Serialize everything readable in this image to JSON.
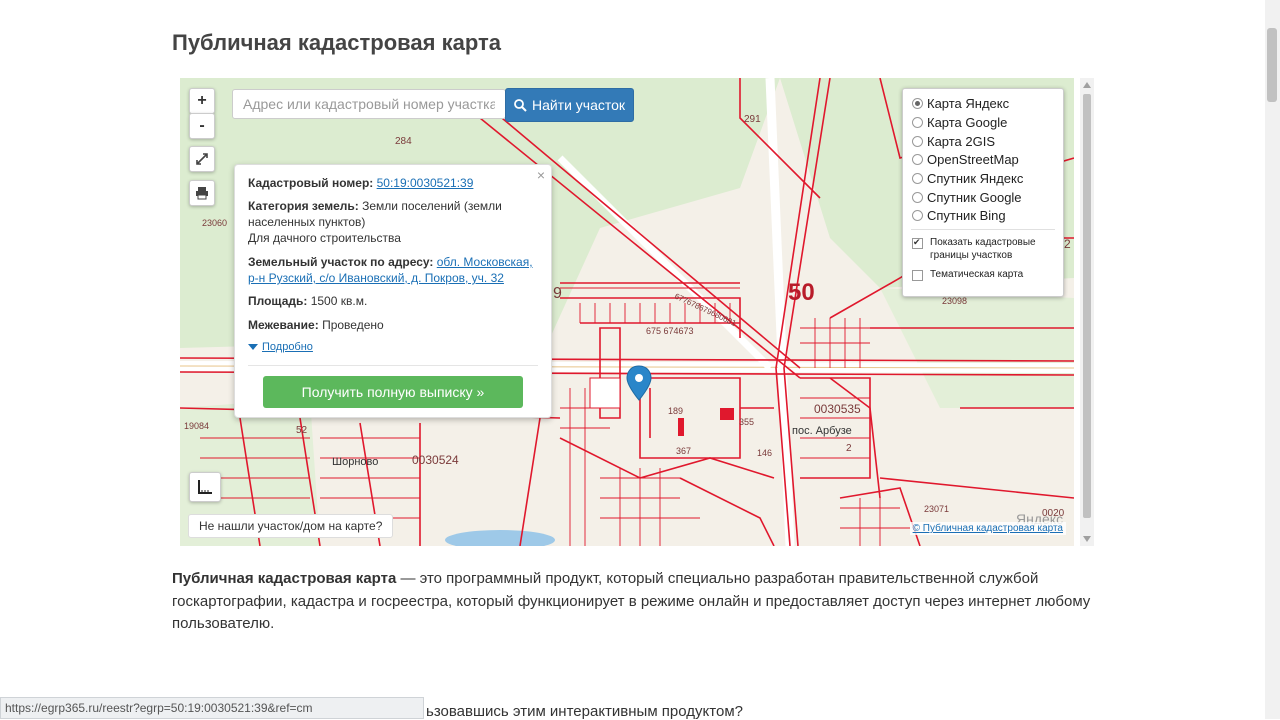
{
  "page": {
    "title": "Публичная кадастровая карта",
    "intro_bold": "Публичная кадастровая карта",
    "intro_rest": " — это программный продукт, который специально разработан правительственной службой госкартографии, кадастра и госреестра, который функционирует в режиме онлайн и предоставляет доступ через интернет любому пользователю.",
    "next_fragment": "ьзовавшись этим интерактивным продуктом?"
  },
  "map": {
    "zoom_in": "+",
    "zoom_out": "-",
    "search_placeholder": "Адрес или кадастровый номер участка",
    "search_button": "Найти участок",
    "not_found_button": "Не нашли участок/дом на карте?",
    "attribution": "© Публичная кадастровая карта",
    "map_labels": {
      "l291": "291",
      "l284": "284",
      "l23060": "23060",
      "l19084": "19084",
      "l52": "52",
      "l9": "9",
      "l50": "50",
      "l23098": "23098",
      "l2": "2",
      "l675": "675 674673",
      "l677": "677678679680681",
      "l189": "189",
      "l355": "355",
      "l367": "367",
      "l146": "146",
      "l0030535": "0030535",
      "l_arbuz": "пос. Арбузе",
      "l2b": "2",
      "l0030524": "0030524",
      "l_shornovo": "Шорново",
      "l23071": "23071",
      "l_yandex": "Яндекс",
      "l0020": "0020"
    }
  },
  "popup": {
    "close": "×",
    "cadastral_label": "Кадастровый номер:",
    "cadastral_value": "50:19:0030521:39",
    "category_label": "Категория земель:",
    "category_value": "Земли поселений (земли населенных пунктов)",
    "usage_value": "Для дачного строительства",
    "address_label": "Земельный участок по адресу:",
    "address_value": "обл. Московская, р-н Рузский, с/о Ивановский, д. Покров, уч. 32",
    "area_label": "Площадь:",
    "area_value": "1500 кв.м.",
    "survey_label": "Межевание:",
    "survey_value": "Проведено",
    "more_link": "Подробно",
    "get_button": "Получить полную выписку »"
  },
  "layers": {
    "options": [
      {
        "label": "Карта Яндекс",
        "selected": true
      },
      {
        "label": "Карта Google",
        "selected": false
      },
      {
        "label": "Карта 2GIS",
        "selected": false
      },
      {
        "label": "OpenStreetMap",
        "selected": false
      },
      {
        "label": "Спутник Яндекс",
        "selected": false
      },
      {
        "label": "Спутник Google",
        "selected": false
      },
      {
        "label": "Спутник Bing",
        "selected": false
      }
    ],
    "show_borders_label": "Показать кадастровые границы участков",
    "show_borders_checked": true,
    "thematic_label": "Тематическая карта",
    "thematic_checked": false
  },
  "status_bar": {
    "url": "https://egrp365.ru/reestr?egrp=50:19:0030521:39&ref=cm"
  },
  "colors": {
    "primary": "#337ab7",
    "success": "#5cb85c",
    "cadastral": "#e0182d",
    "forest": "#d9ecc9"
  }
}
